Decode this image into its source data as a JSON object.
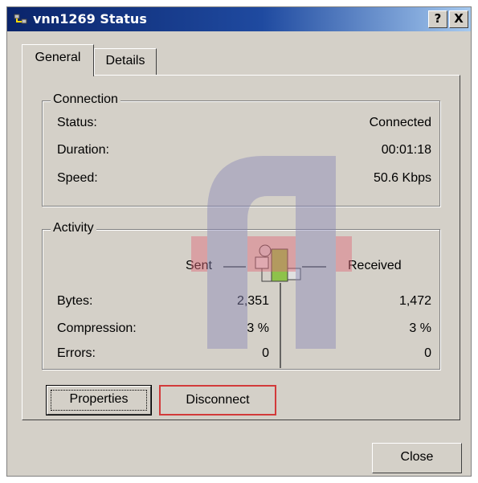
{
  "window": {
    "title": "vnn1269 Status",
    "help_label": "?",
    "close_label": "X"
  },
  "tabs": [
    {
      "label": "General",
      "active": true
    },
    {
      "label": "Details",
      "active": false
    }
  ],
  "connection": {
    "group_label": "Connection",
    "rows": [
      {
        "label": "Status:",
        "value": "Connected"
      },
      {
        "label": "Duration:",
        "value": "00:01:18"
      },
      {
        "label": "Speed:",
        "value": "50.6 Kbps"
      }
    ]
  },
  "activity": {
    "group_label": "Activity",
    "sent_label": "Sent",
    "received_label": "Received",
    "rows": [
      {
        "label": "Bytes:",
        "sent": "2,351",
        "received": "1,472"
      },
      {
        "label": "Compression:",
        "sent": "3 %",
        "received": "3 %"
      },
      {
        "label": "Errors:",
        "sent": "0",
        "received": "0"
      }
    ]
  },
  "buttons": {
    "properties": "Properties",
    "disconnect": "Disconnect",
    "close": "Close"
  },
  "colors": {
    "title_start": "#0a246a",
    "title_end": "#a6caf0",
    "face": "#d4d0c8",
    "highlight_border": "#d23a3a"
  }
}
